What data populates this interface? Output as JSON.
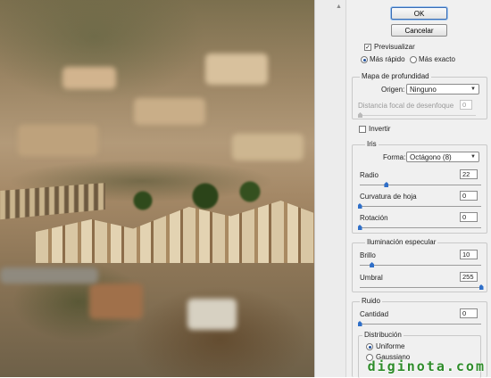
{
  "buttons": {
    "ok": "OK",
    "cancel": "Cancelar"
  },
  "preview": {
    "checkbox_label": "Previsualizar",
    "checked": true,
    "fast": "Más rápido",
    "exact": "Más exacto",
    "selected": "Más rápido"
  },
  "depth_map": {
    "legend": "Mapa de profundidad",
    "source_label": "Origen:",
    "source_value": "Ninguno",
    "focal_label": "Distancia focal de desenfoque",
    "focal_value": "0",
    "invert_label": "Invertir"
  },
  "iris": {
    "legend": "Iris",
    "shape_label": "Forma:",
    "shape_value": "Octágono (8)",
    "radius_label": "Radio",
    "radius_value": "22",
    "radius_level": 0.22,
    "curvature_label": "Curvatura de hoja",
    "curvature_value": "0",
    "curvature_level": 0,
    "rotation_label": "Rotación",
    "rotation_value": "0",
    "rotation_level": 0
  },
  "specular": {
    "legend": "Iluminación especular",
    "brightness_label": "Brillo",
    "brightness_value": "10",
    "brightness_level": 0.1,
    "threshold_label": "Umbral",
    "threshold_value": "255",
    "threshold_level": 1
  },
  "noise": {
    "legend": "Ruido",
    "amount_label": "Cantidad",
    "amount_value": "0",
    "amount_level": 0,
    "distribution_legend": "Distribución",
    "uniform": "Uniforme",
    "gaussian": "Gaussiano",
    "selected": "Uniforme"
  },
  "watermark": "diginota.com",
  "colors": {
    "accent": "#2f6fc8",
    "watermark": "#2e8c2a",
    "panel_bg": "#f0f0f0"
  }
}
